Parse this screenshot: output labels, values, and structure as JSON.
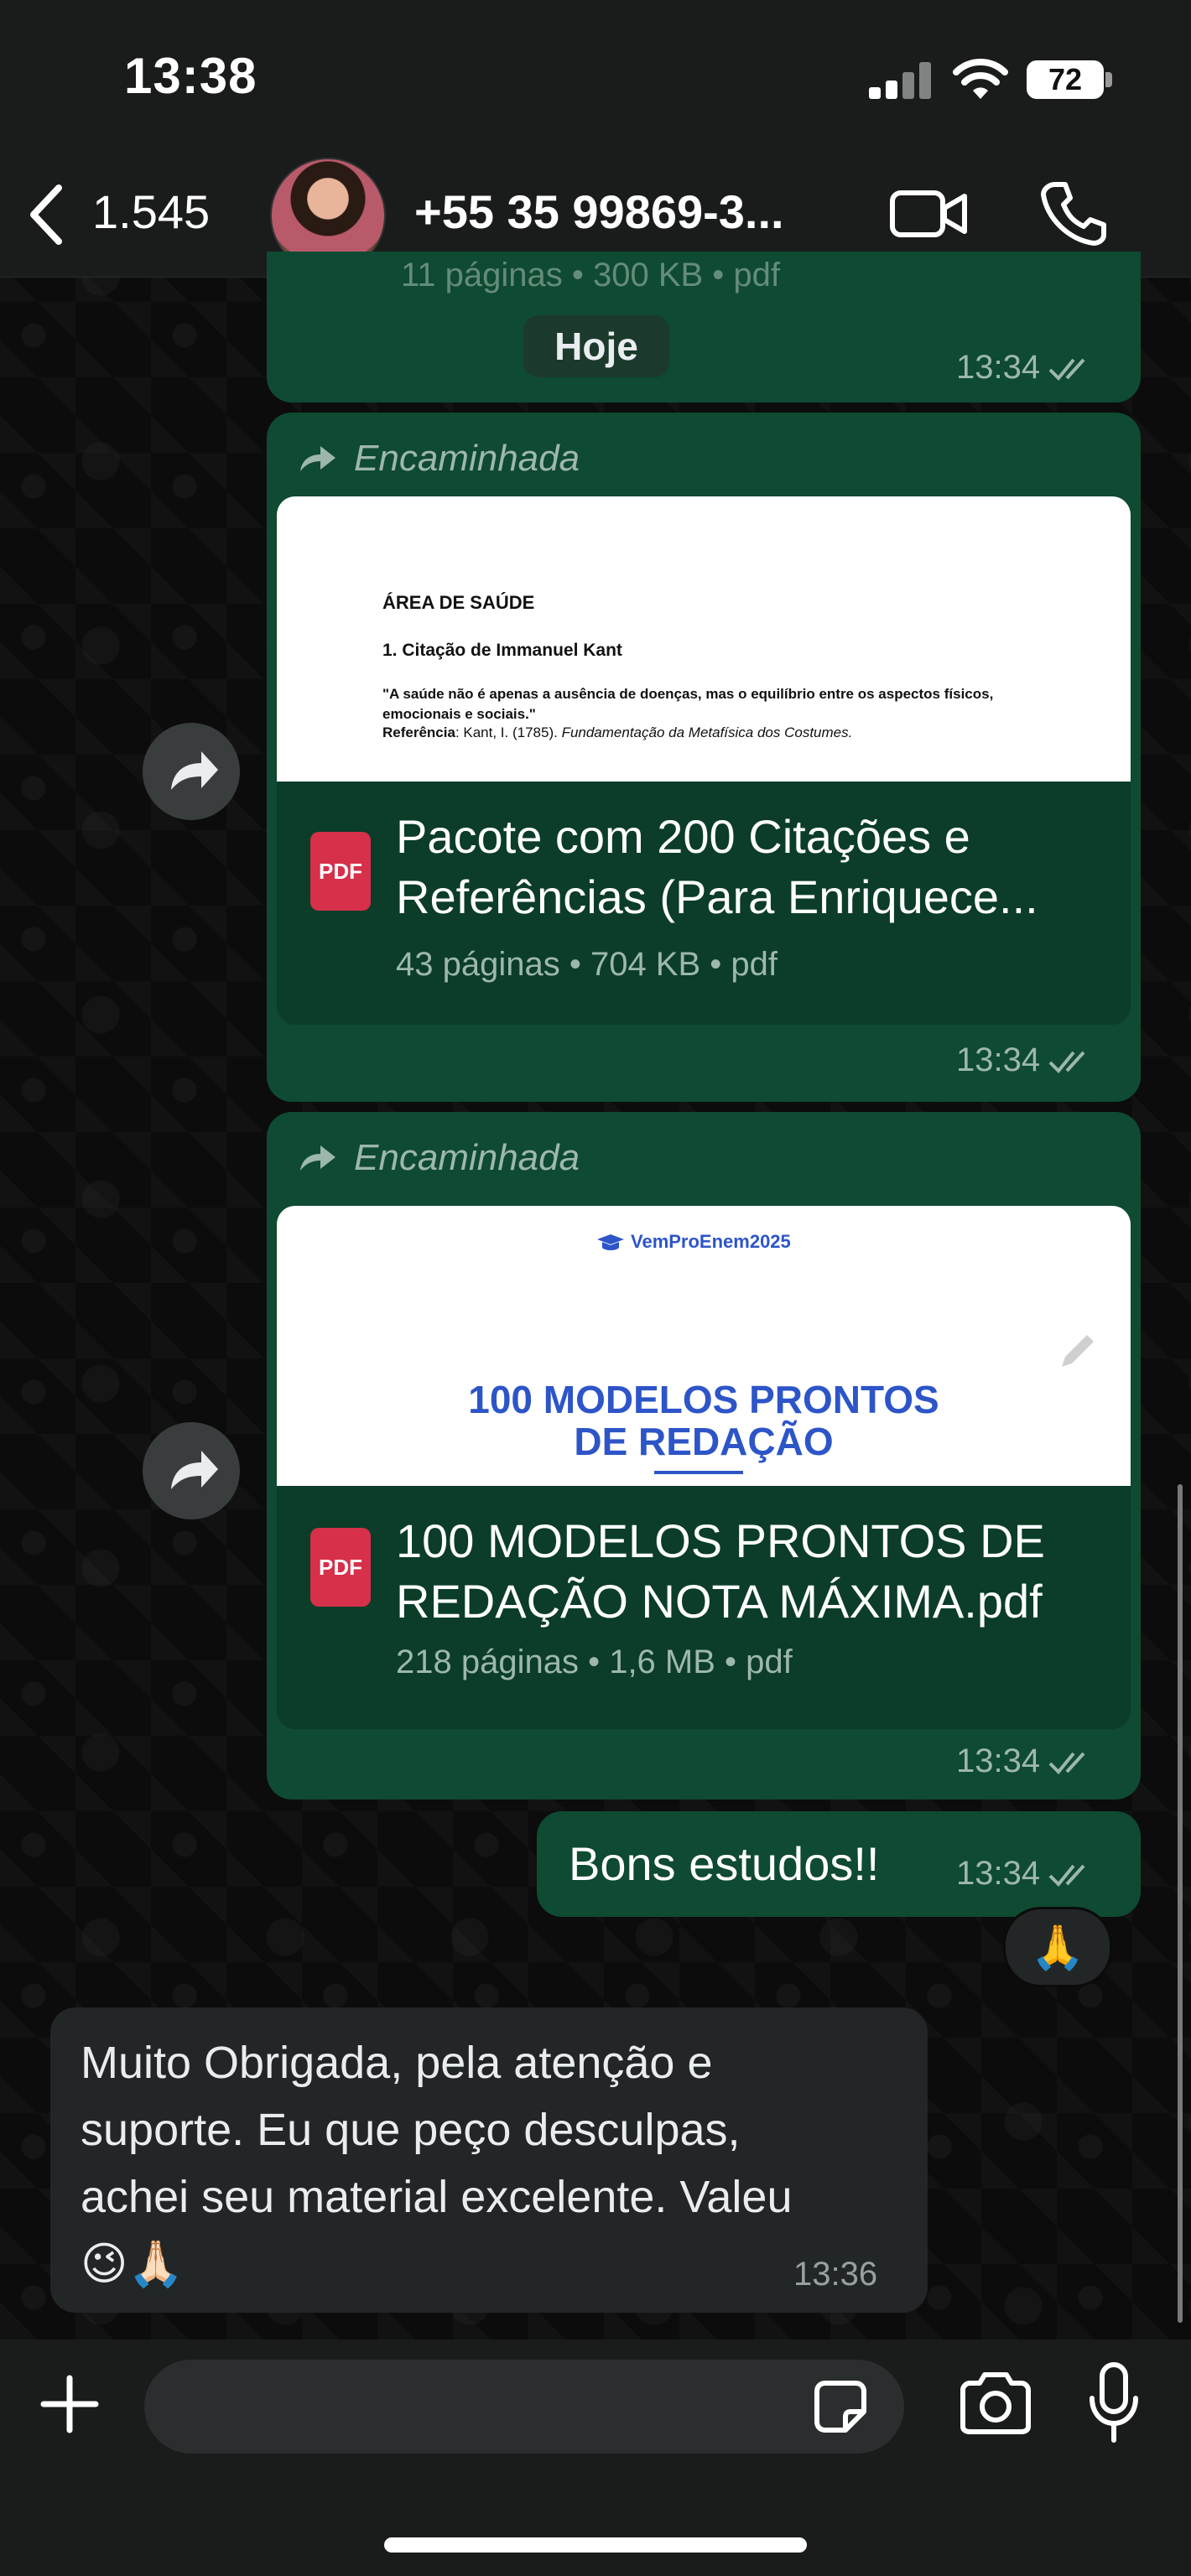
{
  "status": {
    "time": "13:38",
    "battery": "72"
  },
  "header": {
    "unread_count": "1.545",
    "contact": "+55 35 99869-3..."
  },
  "date_chip": "Hoje",
  "top_bubble": {
    "partial_meta": "11 páginas • 300 KB • pdf",
    "time": "13:34"
  },
  "messages": [
    {
      "forwarded": "Encaminhada",
      "preview": {
        "heading": "ÁREA DE SAÚDE",
        "subheading": "1. Citação de Immanuel Kant",
        "quote": "\"A saúde não é apenas a ausência de doenças, mas o equilíbrio entre os aspectos físicos, emocionais e sociais.\"",
        "ref_label": "Referência",
        "ref_text": ": Kant, I. (1785). ",
        "ref_italic": "Fundamentação da Metafísica dos Costumes."
      },
      "doc_title_1": "Pacote com 200 Citações e",
      "doc_title_2": "Referências (Para Enriquece...",
      "doc_meta": "43 páginas • 704 KB • pdf",
      "time": "13:34"
    },
    {
      "forwarded": "Encaminhada",
      "preview": {
        "brand": "VemProEnem2025",
        "title_1": "100 MODELOS PRONTOS",
        "title_2": "DE REDAÇÃO"
      },
      "doc_title_1": "100 MODELOS PRONTOS DE",
      "doc_title_2": "REDAÇÃO NOTA MÁXIMA.pdf",
      "doc_meta": "218 páginas • 1,6 MB • pdf",
      "time": "13:34"
    },
    {
      "text": "Bons estudos!!",
      "time": "13:34",
      "reaction": "🙏"
    },
    {
      "lines": [
        "Muito Obrigada, pela atenção  e",
        "suporte. Eu que peço desculpas,",
        "achei seu material excelente. Valeu",
        "😉🙏🏻"
      ],
      "time": "13:36"
    }
  ],
  "pdf_badge": "PDF",
  "colors": {
    "outgoing": "#0f4a32",
    "incoming": "#232626",
    "accent_blue": "#2d55c8"
  }
}
